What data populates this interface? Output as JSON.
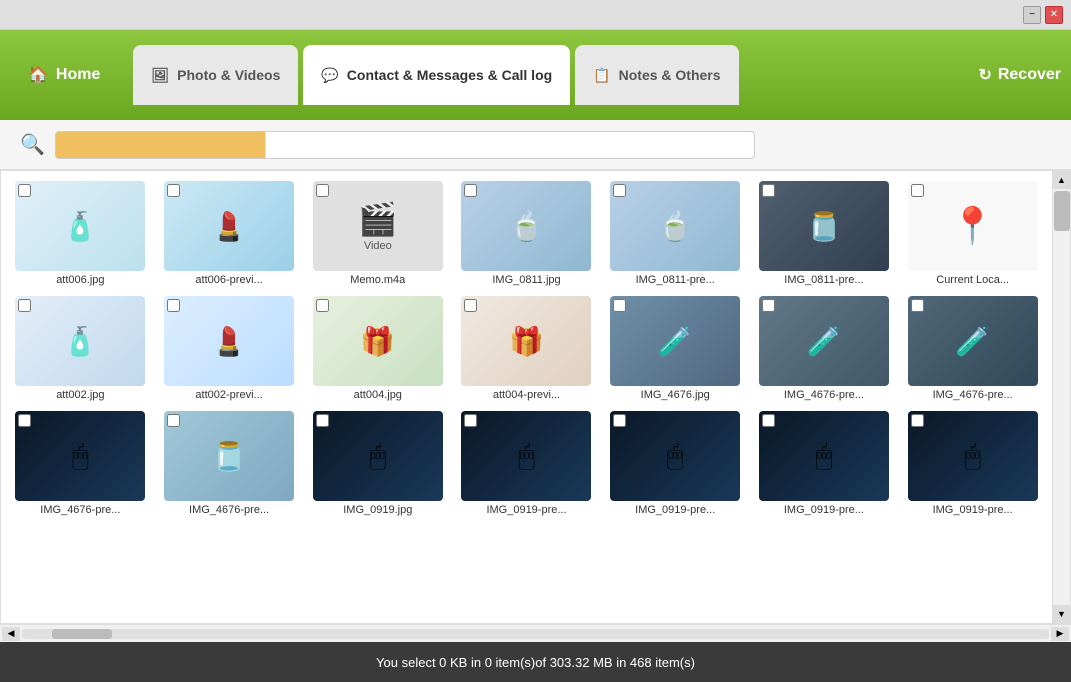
{
  "titlebar": {
    "minimize_label": "−",
    "close_label": "✕"
  },
  "navbar": {
    "home_label": "Home",
    "tabs": [
      {
        "id": "photos",
        "label": "Photo & Videos",
        "icon": "🖼"
      },
      {
        "id": "contacts",
        "label": "Contact & Messages & Call log",
        "icon": "💬"
      },
      {
        "id": "notes",
        "label": "Notes & Others",
        "icon": "📋"
      }
    ],
    "recover_label": "Recover",
    "recover_icon": "↻"
  },
  "search": {
    "placeholder": ""
  },
  "status": {
    "text": "You select 0 KB in 0 item(s)of 303.32 MB in 468 item(s)"
  },
  "grid_items": [
    {
      "id": 1,
      "label": "att006.jpg",
      "type": "cosmetic",
      "emoji": "🧴"
    },
    {
      "id": 2,
      "label": "att006-previ...",
      "type": "cosmetic2",
      "emoji": "💄"
    },
    {
      "id": 3,
      "label": "Memo.m4a",
      "type": "video",
      "emoji": "🎬"
    },
    {
      "id": 4,
      "label": "IMG_0811.jpg",
      "type": "bowls",
      "emoji": "🍵"
    },
    {
      "id": 5,
      "label": "IMG_0811-pre...",
      "type": "bowls",
      "emoji": "🍵"
    },
    {
      "id": 6,
      "label": "IMG_0811-pre...",
      "type": "bowls_dark",
      "emoji": "🫙"
    },
    {
      "id": 7,
      "label": "Current Loca...",
      "type": "pin",
      "emoji": "📍"
    },
    {
      "id": 8,
      "label": "att002.jpg",
      "type": "cosmetic3",
      "emoji": "🧴"
    },
    {
      "id": 9,
      "label": "att002-previ...",
      "type": "cosmetic4",
      "emoji": "💄"
    },
    {
      "id": 10,
      "label": "att004.jpg",
      "type": "cosmetic5",
      "emoji": "🎁"
    },
    {
      "id": 11,
      "label": "att004-previ...",
      "type": "cosmetic6",
      "emoji": "🎁"
    },
    {
      "id": 12,
      "label": "IMG_4676.jpg",
      "type": "bottles",
      "emoji": "🧪"
    },
    {
      "id": 13,
      "label": "IMG_4676-pre...",
      "type": "bottles2",
      "emoji": "🧪"
    },
    {
      "id": 14,
      "label": "IMG_4676-pre...",
      "type": "bottles3",
      "emoji": "🧪"
    },
    {
      "id": 15,
      "label": "IMG_4676-pre...",
      "type": "mouse",
      "emoji": "🖱"
    },
    {
      "id": 16,
      "label": "IMG_4676-pre...",
      "type": "bowls2",
      "emoji": "🫙"
    },
    {
      "id": 17,
      "label": "IMG_0919.jpg",
      "type": "mouse2",
      "emoji": "🖱"
    },
    {
      "id": 18,
      "label": "IMG_0919-pre...",
      "type": "mouse3",
      "emoji": "🖱"
    },
    {
      "id": 19,
      "label": "IMG_0919-pre...",
      "type": "mouse4",
      "emoji": "🖱"
    },
    {
      "id": 20,
      "label": "IMG_0919-pre...",
      "type": "mouse5",
      "emoji": "🖱"
    },
    {
      "id": 21,
      "label": "IMG_0919-pre...",
      "type": "mouse6",
      "emoji": "🖱"
    }
  ]
}
